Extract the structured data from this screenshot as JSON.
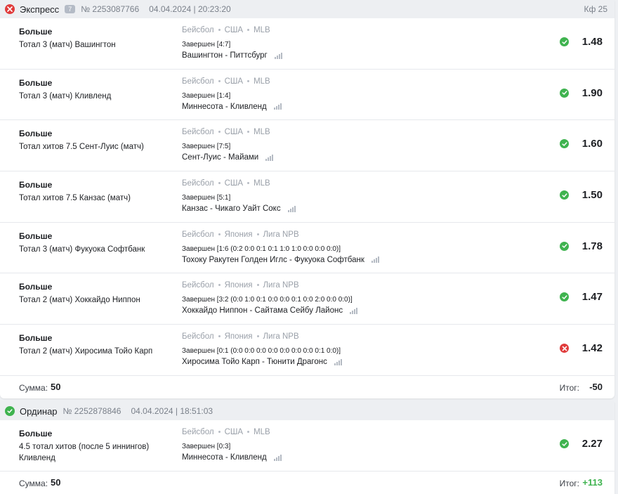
{
  "colors": {
    "win": "#3fb34f",
    "loss": "#e03b3b",
    "positive_total": "#3fb34f",
    "negative_total": "#1d1f23"
  },
  "express": {
    "status": "loss",
    "type": "Экспресс",
    "count": "7",
    "number": "№ 2253087766",
    "datetime": "04.04.2024 | 20:23:20",
    "kf": "Кф 25",
    "bets": [
      {
        "market": "Больше",
        "selection": "Тотал 3 (матч) Вашингтон",
        "sport": "Бейсбол",
        "country": "США",
        "league": "MLB",
        "status": "Завершен [4:7]",
        "teams": "Вашингтон - Питтсбург",
        "result": "win",
        "odds": "1.48"
      },
      {
        "market": "Больше",
        "selection": "Тотал 3 (матч) Кливленд",
        "sport": "Бейсбол",
        "country": "США",
        "league": "MLB",
        "status": "Завершен [1:4]",
        "teams": "Миннесота - Кливленд",
        "result": "win",
        "odds": "1.90"
      },
      {
        "market": "Больше",
        "selection": "Тотал хитов 7.5 Сент-Луис (матч)",
        "sport": "Бейсбол",
        "country": "США",
        "league": "MLB",
        "status": "Завершен [7:5]",
        "teams": "Сент-Луис - Майами",
        "result": "win",
        "odds": "1.60"
      },
      {
        "market": "Больше",
        "selection": "Тотал хитов 7.5 Канзас (матч)",
        "sport": "Бейсбол",
        "country": "США",
        "league": "MLB",
        "status": "Завершен [5:1]",
        "teams": "Канзас - Чикаго Уайт Сокс",
        "result": "win",
        "odds": "1.50"
      },
      {
        "market": "Больше",
        "selection": "Тотал 3 (матч) Фукуока Софтбанк",
        "sport": "Бейсбол",
        "country": "Япония",
        "league": "Лига NPB",
        "status": "Завершен [1:6 (0:2 0:0 0:1 0:1 1:0 1:0 0:0 0:0 0:0)]",
        "teams": "Тохоку Ракутен Голден Иглс - Фукуока Софтбанк",
        "result": "win",
        "odds": "1.78"
      },
      {
        "market": "Больше",
        "selection": "Тотал 2 (матч) Хоккайдо Ниппон",
        "sport": "Бейсбол",
        "country": "Япония",
        "league": "Лига NPB",
        "status": "Завершен [3:2 (0:0 1:0 0:1 0:0 0:0 0:1 0:0 2:0 0:0 0:0)]",
        "teams": "Хоккайдо Ниппон - Сайтама Сейбу Лайонс",
        "result": "win",
        "odds": "1.47"
      },
      {
        "market": "Больше",
        "selection": "Тотал 2 (матч) Хиросима Тойо Карп",
        "sport": "Бейсбол",
        "country": "Япония",
        "league": "Лига NPB",
        "status": "Завершен [0:1 (0:0 0:0 0:0 0:0 0:0 0:0 0:0 0:1 0:0)]",
        "teams": "Хиросима Тойо Карп - Тюнити Драгонс",
        "result": "loss",
        "odds": "1.42"
      }
    ],
    "footer": {
      "sum_label": "Сумма:",
      "sum_value": "50",
      "total_label": "Итог:",
      "total_value": "-50"
    }
  },
  "single": {
    "status": "win",
    "type": "Ординар",
    "number": "№ 2252878846",
    "datetime": "04.04.2024 | 18:51:03",
    "bets": [
      {
        "market": "Больше",
        "selection": "4.5 тотал хитов (после 5 иннингов) Кливленд",
        "sport": "Бейсбол",
        "country": "США",
        "league": "MLB",
        "status": "Завершен [0:3]",
        "teams": "Миннесота - Кливленд",
        "result": "win",
        "odds": "2.27"
      }
    ],
    "footer": {
      "sum_label": "Сумма:",
      "sum_value": "50",
      "total_label": "Итог:",
      "total_value": "+113"
    }
  }
}
